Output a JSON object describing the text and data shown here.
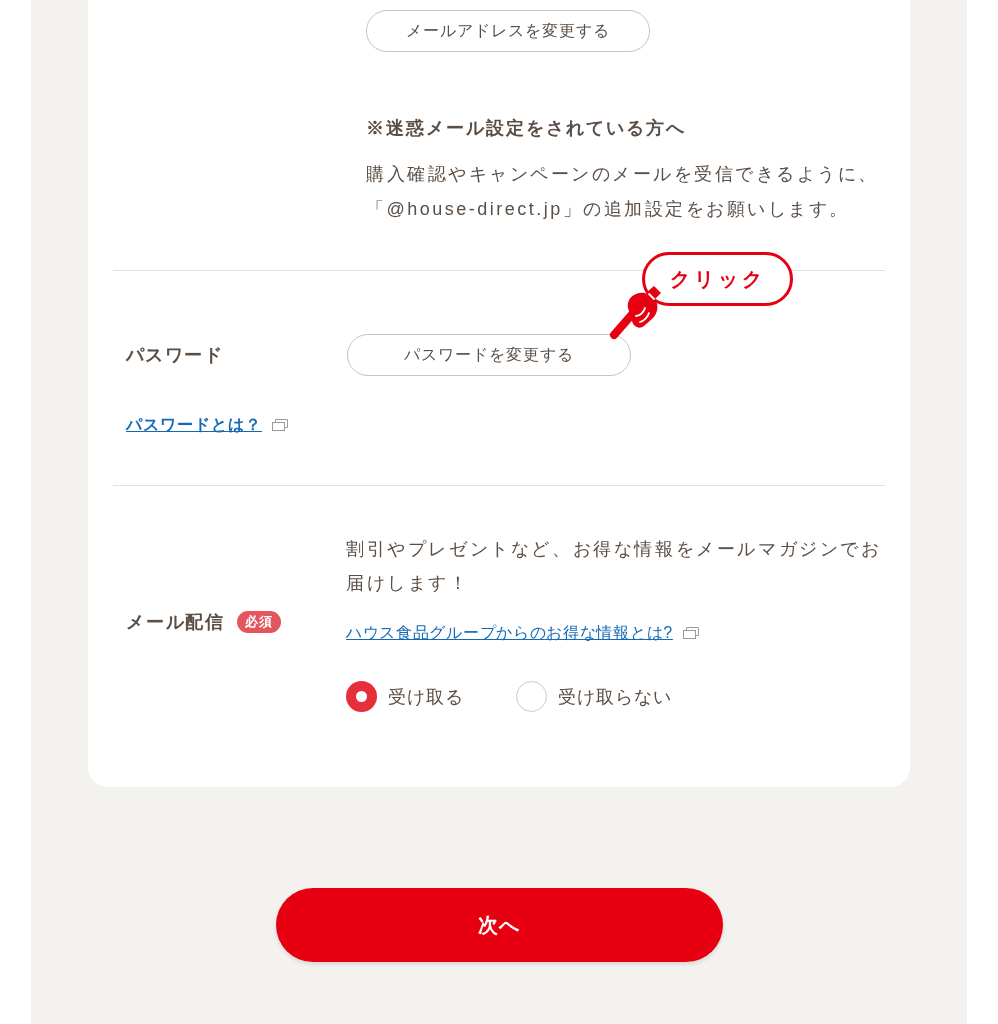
{
  "email_section": {
    "change_button": "メールアドレスを変更する",
    "notice_title": "※迷惑メール設定をされている方へ",
    "notice_text": "購入確認やキャンペーンのメールを受信できるように、「@house-direct.jp」の追加設定をお願いします。"
  },
  "password_section": {
    "label": "パスワード",
    "change_button": "パスワードを変更する",
    "help_link": "パスワードとは？",
    "callout": "クリック"
  },
  "newsletter_section": {
    "label": "メール配信",
    "required_badge": "必須",
    "description": "割引やプレゼントなど、お得な情報をメールマガジンでお届けします！",
    "info_link": "ハウス食品グループからのお得な情報とは?",
    "options": [
      {
        "label": "受け取る",
        "selected": true
      },
      {
        "label": "受け取らない",
        "selected": false
      }
    ]
  },
  "next_button": "次へ"
}
